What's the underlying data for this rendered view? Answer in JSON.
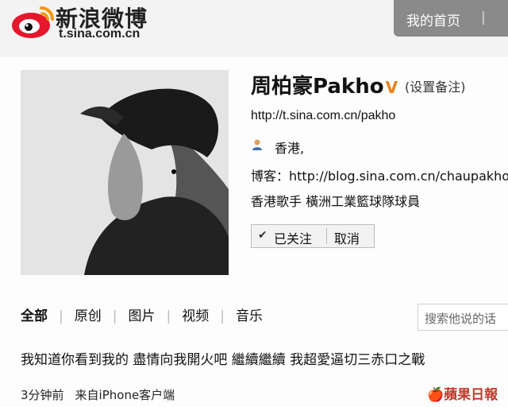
{
  "header": {
    "logo_text": "新浪微博",
    "logo_url": "t.sina.com.cn",
    "nav_home": "我的首页",
    "nav_separator": "|"
  },
  "profile": {
    "name": "周柏豪Pakho",
    "verified_mark": "V",
    "remark_link": "(设置备注)",
    "url": "http://t.sina.com.cn/pakho",
    "location": "香港,",
    "blog": "博客：http://blog.sina.com.cn/chaupakho",
    "bio": "香港歌手 橫洲工業籃球隊球員",
    "followed_label": "已关注",
    "cancel_label": "取消"
  },
  "tabs": [
    {
      "label": "全部"
    },
    {
      "label": "原创"
    },
    {
      "label": "图片"
    },
    {
      "label": "视频"
    },
    {
      "label": "音乐"
    }
  ],
  "tab_separator": "|",
  "search": {
    "placeholder": "搜索他说的话"
  },
  "post": {
    "text": "我知道你看到我的 盡情向我開火吧 繼續繼續 我超愛逼切三赤口之戰",
    "time": "3分钟前",
    "source": "来自iPhone客户端"
  },
  "watermark": {
    "text": "蘋果日報",
    "icon": "apple-icon"
  },
  "colors": {
    "verified": "#e8821c",
    "watermark": "#c0392b"
  }
}
